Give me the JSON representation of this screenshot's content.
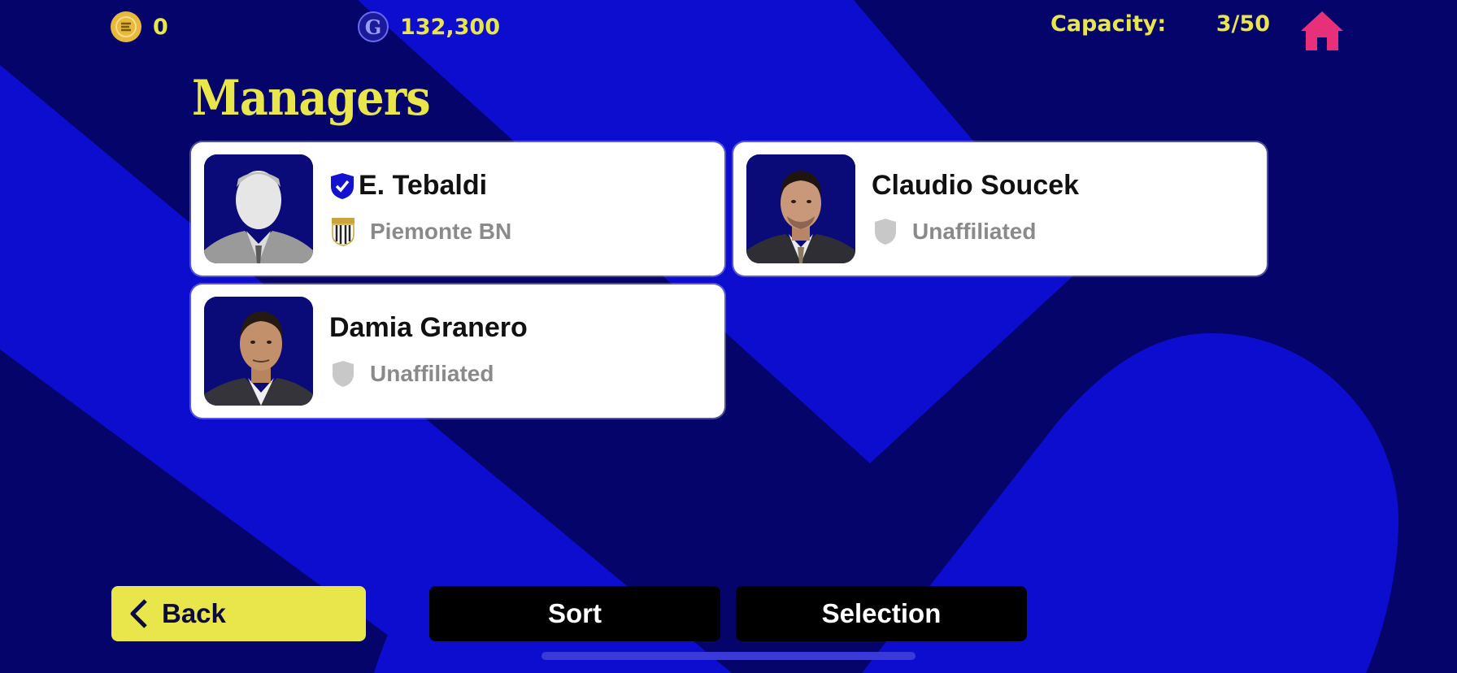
{
  "header": {
    "efootball_coins": "0",
    "gp": "132,300",
    "capacity_label": "Capacity:",
    "capacity_value": "3/50",
    "home_icon": "home-icon"
  },
  "page": {
    "title": "Managers"
  },
  "managers": [
    {
      "name": "E. Tebaldi",
      "club": "Piemonte BN",
      "verified": true
    },
    {
      "name": "Claudio Soucek",
      "club": "Unaffiliated",
      "verified": false
    },
    {
      "name": "Damia Granero",
      "club": "Unaffiliated",
      "verified": false
    }
  ],
  "footer": {
    "back_label": "Back",
    "sort_label": "Sort",
    "selection_label": "Selection"
  },
  "colors": {
    "background": "#04046a",
    "accent_yellow": "#e8e64a",
    "home_pink": "#e8307a",
    "shape_blue": "#0d0dcf"
  }
}
